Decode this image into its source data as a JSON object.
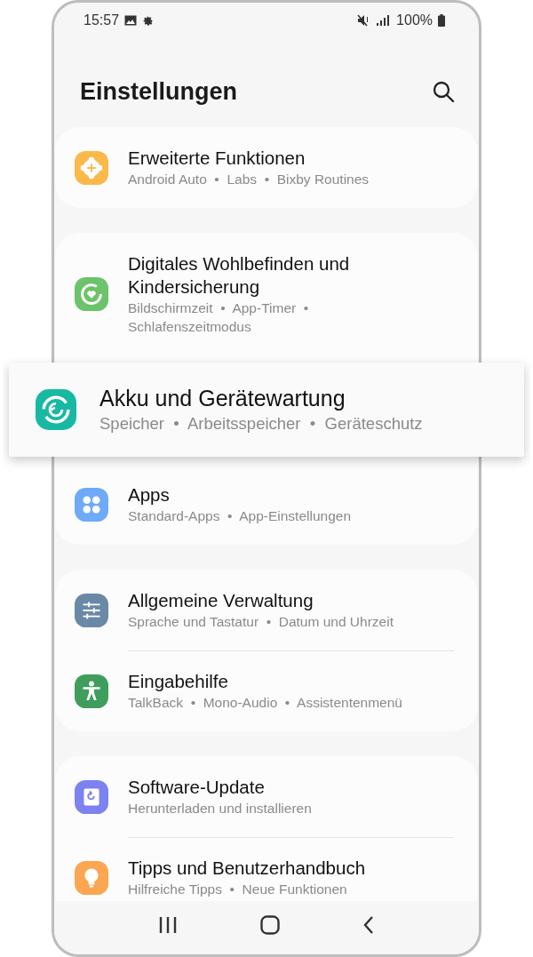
{
  "status_bar": {
    "time": "15:57",
    "battery": "100%"
  },
  "header": {
    "title": "Einstellungen"
  },
  "groups": [
    {
      "items": [
        {
          "kind": "gear-plus",
          "title": "Erweiterte Funktionen",
          "subtitle": "Android Auto  •  Labs  •  Bixby Routines",
          "highlighted": false
        }
      ]
    },
    {
      "items": [
        {
          "kind": "wellbeing",
          "title": "Digitales Wohlbefinden und Kindersicherung",
          "subtitle": "Bildschirmzeit  •  App-Timer  •\nSchlafenszeitmodus",
          "highlighted": false
        },
        {
          "kind": "care",
          "title": "Akku und Gerätewartung",
          "subtitle": "Speicher  •  Arbeitsspeicher  •  Geräteschutz",
          "highlighted": true
        },
        {
          "kind": "apps",
          "title": "Apps",
          "subtitle": "Standard-Apps  •  App-Einstellungen",
          "highlighted": false
        }
      ]
    },
    {
      "items": [
        {
          "kind": "sliders",
          "title": "Allgemeine Verwaltung",
          "subtitle": "Sprache und Tastatur  •  Datum und Uhrzeit",
          "highlighted": false
        },
        {
          "kind": "accessibility",
          "title": "Eingabehilfe",
          "subtitle": "TalkBack  •  Mono-Audio  •  Assistentenmenü",
          "highlighted": false
        }
      ]
    },
    {
      "items": [
        {
          "kind": "update",
          "title": "Software-Update",
          "subtitle": "Herunterladen und installieren",
          "highlighted": false
        },
        {
          "kind": "bulb",
          "title": "Tipps und Benutzerhandbuch",
          "subtitle": "Hilfreiche Tipps  •  Neue Funktionen",
          "highlighted": false
        }
      ]
    }
  ]
}
